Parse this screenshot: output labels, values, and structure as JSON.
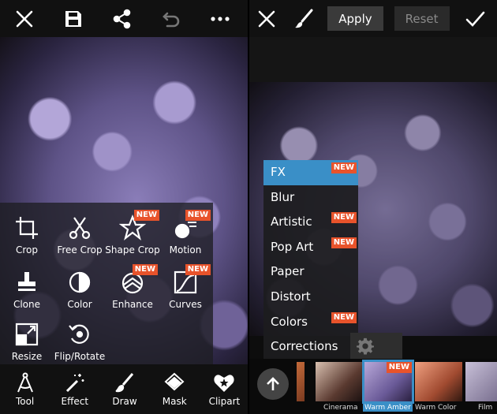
{
  "left": {
    "tools": [
      {
        "label": "Crop",
        "icon": "crop-icon",
        "new": false
      },
      {
        "label": "Free Crop",
        "icon": "scissors-icon",
        "new": false
      },
      {
        "label": "Shape Crop",
        "icon": "star-icon",
        "new": true
      },
      {
        "label": "Motion",
        "icon": "motion-icon",
        "new": true
      },
      {
        "label": "Clone",
        "icon": "stamp-icon",
        "new": false
      },
      {
        "label": "Color",
        "icon": "half-circle-icon",
        "new": false
      },
      {
        "label": "Enhance",
        "icon": "enhance-icon",
        "new": true
      },
      {
        "label": "Curves",
        "icon": "curves-icon",
        "new": true
      },
      {
        "label": "Resize",
        "icon": "resize-icon",
        "new": false
      },
      {
        "label": "Flip/Rotate",
        "icon": "rotate-icon",
        "new": false
      }
    ],
    "bottom": [
      {
        "label": "Tool",
        "icon": "compass-icon"
      },
      {
        "label": "Effect",
        "icon": "magic-wand-icon"
      },
      {
        "label": "Draw",
        "icon": "brush-icon"
      },
      {
        "label": "Mask",
        "icon": "mask-icon"
      },
      {
        "label": "Clipart",
        "icon": "heart-star-icon"
      }
    ],
    "new_label": "NEW"
  },
  "right": {
    "apply_label": "Apply",
    "reset_label": "Reset",
    "menu": [
      {
        "label": "FX",
        "new": true,
        "active": true
      },
      {
        "label": "Blur",
        "new": false,
        "active": false
      },
      {
        "label": "Artistic",
        "new": true,
        "active": false
      },
      {
        "label": "Pop Art",
        "new": true,
        "active": false
      },
      {
        "label": "Paper",
        "new": false,
        "active": false
      },
      {
        "label": "Distort",
        "new": false,
        "active": false
      },
      {
        "label": "Colors",
        "new": true,
        "active": false
      },
      {
        "label": "Corrections",
        "new": false,
        "active": false
      }
    ],
    "thumbs": [
      {
        "label": "Cinerama",
        "selected": false,
        "new": false
      },
      {
        "label": "Warm Amber",
        "selected": true,
        "new": true
      },
      {
        "label": "Warm Color",
        "selected": false,
        "new": false
      },
      {
        "label": "Film",
        "selected": false,
        "new": false
      }
    ]
  },
  "colors": {
    "accent": "#3a8fc7",
    "new_badge": "#e8532b"
  }
}
